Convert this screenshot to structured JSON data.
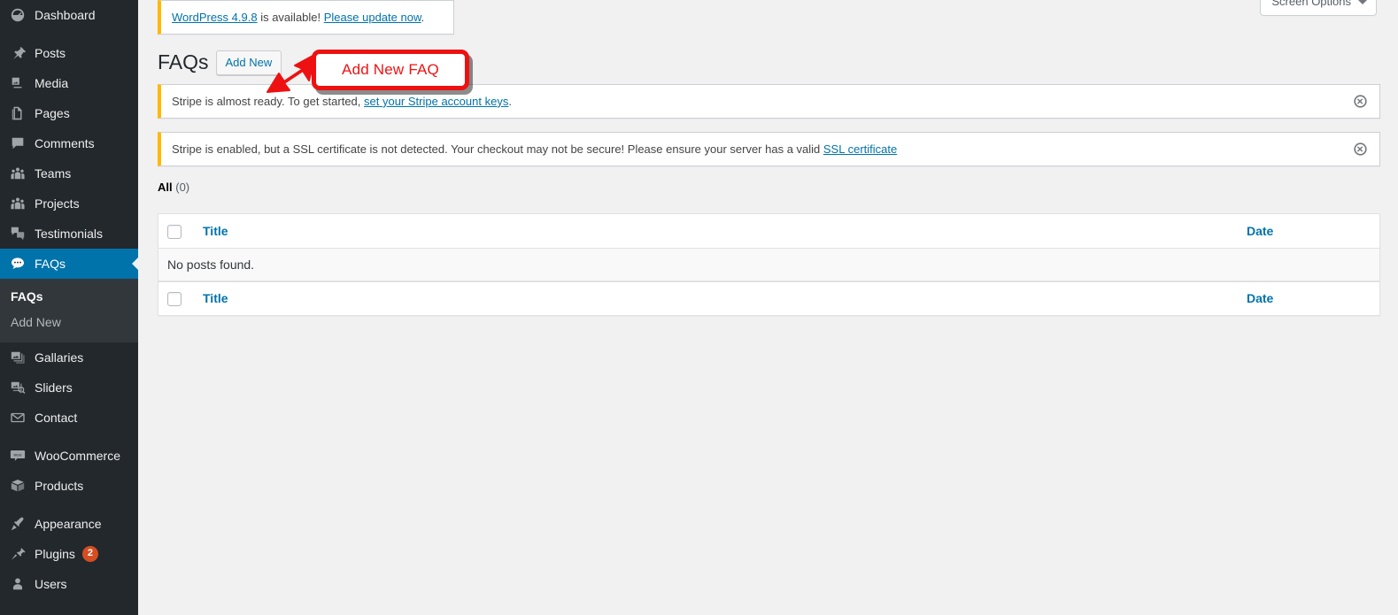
{
  "sidebar": {
    "items": [
      {
        "label": "Dashboard",
        "icon": "dashboard-icon",
        "current": false,
        "gap_after": true
      },
      {
        "label": "Posts",
        "icon": "pin-icon",
        "current": false,
        "gap_after": false
      },
      {
        "label": "Media",
        "icon": "media-icon",
        "current": false,
        "gap_after": false
      },
      {
        "label": "Pages",
        "icon": "pages-icon",
        "current": false,
        "gap_after": false
      },
      {
        "label": "Comments",
        "icon": "comments-icon",
        "current": false,
        "gap_after": false
      },
      {
        "label": "Teams",
        "icon": "groups-icon",
        "current": false,
        "gap_after": false
      },
      {
        "label": "Projects",
        "icon": "groups-icon",
        "current": false,
        "gap_after": false
      },
      {
        "label": "Testimonials",
        "icon": "testimonials-icon",
        "current": false,
        "gap_after": false
      },
      {
        "label": "FAQs",
        "icon": "faq-bubble-icon",
        "current": true,
        "gap_after": false
      },
      {
        "label": "Gallaries",
        "icon": "gallery-icon",
        "current": false,
        "gap_after": false
      },
      {
        "label": "Sliders",
        "icon": "slider-icon",
        "current": false,
        "gap_after": false
      },
      {
        "label": "Contact",
        "icon": "envelope-icon",
        "current": false,
        "gap_after": true
      },
      {
        "label": "WooCommerce",
        "icon": "woo-icon",
        "current": false,
        "gap_after": false
      },
      {
        "label": "Products",
        "icon": "product-box-icon",
        "current": false,
        "gap_after": true
      },
      {
        "label": "Appearance",
        "icon": "brush-icon",
        "current": false,
        "gap_after": false
      },
      {
        "label": "Plugins",
        "icon": "plug-icon",
        "current": false,
        "badge": "2",
        "gap_after": false
      },
      {
        "label": "Users",
        "icon": "user-icon",
        "current": false,
        "gap_after": false
      }
    ],
    "submenu": {
      "parent": "FAQs",
      "items": [
        {
          "label": "FAQs",
          "current": true
        },
        {
          "label": "Add New",
          "current": false
        }
      ]
    }
  },
  "screen_meta": {
    "screen_options_label": "Screen Options",
    "caret_icon": "chevron-down-icon"
  },
  "update_nag": {
    "link_version": "WordPress 4.9.8",
    "middle_text": " is available! ",
    "link_update": "Please update now",
    "trailing": "."
  },
  "page": {
    "title": "FAQs",
    "add_new_label": "Add New"
  },
  "notices": [
    {
      "name": "stripe-keys-notice",
      "text_before": "Stripe is almost ready. To get started, ",
      "link_text": "set your Stripe account keys",
      "text_after": ".",
      "dismiss_icon": "dismiss-circle-icon"
    },
    {
      "name": "stripe-ssl-notice",
      "text_before": "Stripe is enabled, but a SSL certificate is not detected. Your checkout may not be secure! Please ensure your server has a valid ",
      "link_text": "SSL certificate",
      "text_after": "",
      "dismiss_icon": "dismiss-circle-icon"
    }
  ],
  "filters": {
    "all_label": "All",
    "all_count": "(0)"
  },
  "table": {
    "columns": {
      "title": "Title",
      "date": "Date"
    },
    "empty_message": "No posts found.",
    "rows": []
  },
  "annotation": {
    "callout_text": "Add New FAQ",
    "arrow_icon": "arrow-down-left-icon",
    "color": "#ee1111"
  },
  "colors": {
    "sidebar_bg": "#23282d",
    "submenu_bg": "#32373c",
    "accent_blue": "#0073aa",
    "notice_border": "#ffb900",
    "badge_orange": "#d54e21",
    "page_bg": "#f1f1f1"
  }
}
